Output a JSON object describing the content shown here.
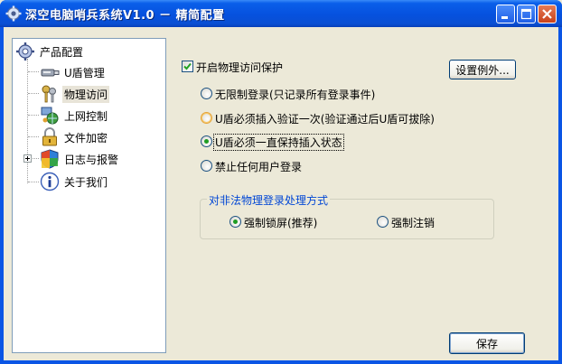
{
  "window": {
    "title": "深空电脑哨兵系统V1.0 － 精简配置",
    "controls": [
      "minimize",
      "maximize",
      "close"
    ],
    "accent": "#0A55E5"
  },
  "tree": {
    "root": {
      "label": "产品配置",
      "icon": "gear-icon"
    },
    "items": [
      {
        "label": "U盾管理",
        "icon": "usb-key-icon"
      },
      {
        "label": "物理访问",
        "icon": "keys-icon",
        "selected": true
      },
      {
        "label": "上网控制",
        "icon": "network-globe-icon"
      },
      {
        "label": "文件加密",
        "icon": "padlock-icon"
      },
      {
        "label": "日志与报警",
        "icon": "shield-icon",
        "expandable": true
      },
      {
        "label": "关于我们",
        "icon": "info-icon"
      }
    ]
  },
  "physical_access": {
    "enable_checkbox": {
      "label": "开启物理访问保护",
      "checked": true
    },
    "exceptions_button": "设置例外...",
    "modes": [
      {
        "label": "无限制登录(只记录所有登录事件)",
        "checked": false
      },
      {
        "label": "U盾必须插入验证一次(验证通过后U盾可拔除)",
        "checked": false
      },
      {
        "label": "U盾必须一直保持插入状态",
        "checked": true
      },
      {
        "label": "禁止任何用户登录",
        "checked": false
      }
    ],
    "illegal_login": {
      "title": "对非法物理登录处理方式",
      "options": [
        {
          "label": "强制锁屏(推荐)",
          "checked": true
        },
        {
          "label": "强制注销",
          "checked": false
        }
      ]
    }
  },
  "footer": {
    "save_button": "保存"
  }
}
